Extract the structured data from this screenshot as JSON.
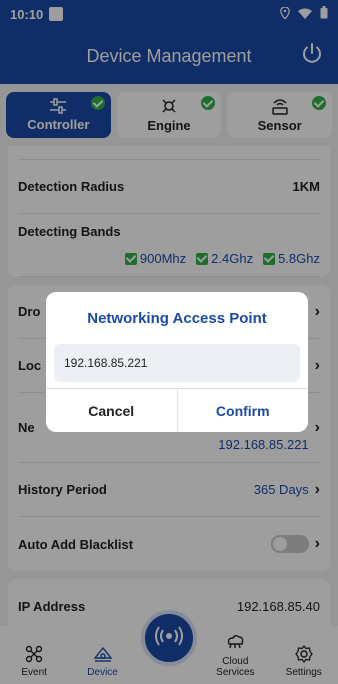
{
  "status": {
    "time": "10:10"
  },
  "header": {
    "title": "Device Management"
  },
  "tabs": [
    {
      "label": "Controller",
      "checked": true,
      "active": true,
      "icon": "sliders-icon"
    },
    {
      "label": "Engine",
      "checked": true,
      "active": false,
      "icon": "drone-icon"
    },
    {
      "label": "Sensor",
      "checked": true,
      "active": false,
      "icon": "antenna-icon"
    }
  ],
  "settings": {
    "detection_radius": {
      "label": "Detection Radius",
      "value": "1KM"
    },
    "detecting_bands": {
      "label": "Detecting Bands",
      "bands": [
        "900Mhz",
        "2.4Ghz",
        "5.8Ghz"
      ]
    },
    "row_a": {
      "label": "Dro"
    },
    "row_b": {
      "label": "Loc"
    },
    "networking": {
      "label": "Ne",
      "value": "192.168.85.221"
    },
    "history_period": {
      "label": "History Period",
      "value": "365 Days"
    },
    "auto_add_blacklist": {
      "label": "Auto Add Blacklist"
    },
    "ip_address": {
      "label": "IP Address",
      "value": "192.168.85.40"
    }
  },
  "dialog": {
    "title": "Networking Access Point",
    "input_value": "192.168.85.221",
    "cancel": "Cancel",
    "confirm": "Confirm"
  },
  "nav": [
    {
      "label": "Event",
      "icon": "event-icon",
      "active": false
    },
    {
      "label": "Device",
      "icon": "device-icon",
      "active": true
    },
    {
      "label": "Cloud Services",
      "icon": "cloud-icon",
      "active": false
    },
    {
      "label": "Settings",
      "icon": "settings-icon",
      "active": false
    }
  ],
  "colors": {
    "primary": "#1b4aa6",
    "check": "#2fb24a"
  }
}
